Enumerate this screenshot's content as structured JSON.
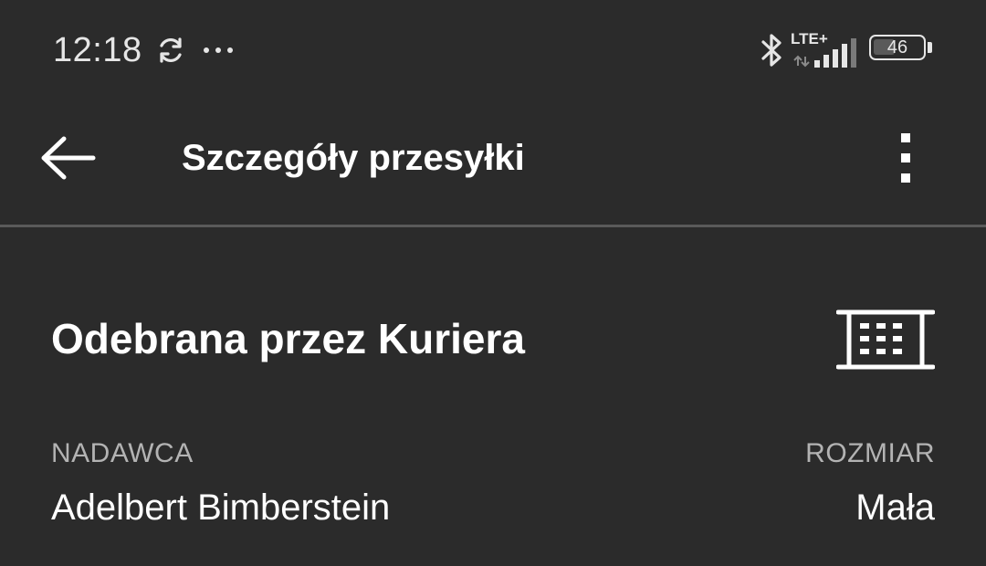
{
  "status_bar": {
    "time": "12:18",
    "network": "LTE+",
    "battery_level": "46",
    "icons": [
      "sync-icon",
      "more-dots-icon",
      "bluetooth-icon",
      "signal-icon",
      "battery-icon"
    ]
  },
  "app_bar": {
    "title": "Szczegóły przesyłki",
    "back_icon": "arrow-left-icon",
    "menu_icon": "more-vertical-icon"
  },
  "shipment": {
    "status": "Odebrana przez Kuriera",
    "status_icon": "parcel-locker-icon",
    "sender_label": "NADAWCA",
    "sender_name": "Adelbert Bimberstein",
    "size_label": "ROZMIAR",
    "size_value": "Mała"
  },
  "colors": {
    "background": "#2b2b2b",
    "text_primary": "#ffffff",
    "text_secondary": "#b3b3b3",
    "divider": "#5a5a5a"
  }
}
